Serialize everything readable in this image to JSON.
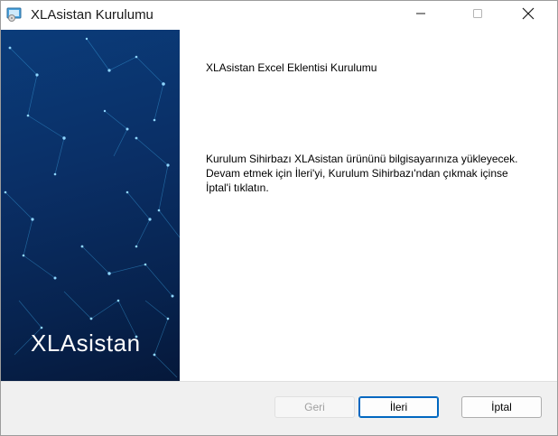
{
  "window": {
    "title": "XLAsistan Kurulumu"
  },
  "banner": {
    "brand": "XLAsistan"
  },
  "content": {
    "heading": "XLAsistan Excel Eklentisi Kurulumu",
    "description_lines": [
      "Kurulum Sihirbazı XLAsistan ürününü bilgisayarınıza yükleyecek.",
      "Devam etmek için İleri'yi, Kurulum Sihirbazı'ndan çıkmak içinse",
      "İptal'i tıklatın."
    ]
  },
  "buttons": {
    "back": "Geri",
    "back_enabled": false,
    "next": "İleri",
    "cancel": "İptal"
  },
  "icons": {
    "app": "installer-icon",
    "minimize": "minimize-icon",
    "maximize": "maximize-icon",
    "close": "close-icon"
  },
  "colors": {
    "banner_dark": "#07234f",
    "banner_light": "#0b3c7a",
    "accent": "#0067c0",
    "footer_bg": "#f0f0f0"
  }
}
